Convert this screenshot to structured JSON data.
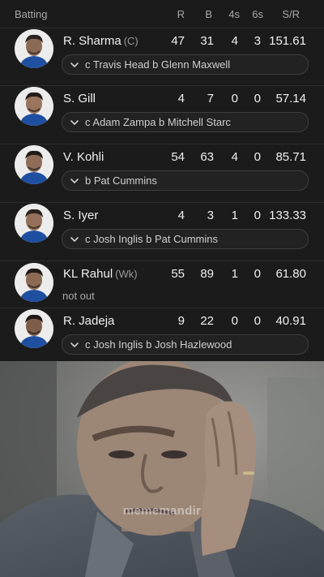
{
  "header": {
    "title": "Batting",
    "columns": [
      "R",
      "B",
      "4s",
      "6s",
      "S/R"
    ]
  },
  "batters": [
    {
      "name": "R. Sharma",
      "role": "(C)",
      "r": "47",
      "b": "31",
      "fours": "4",
      "sixes": "3",
      "sr": "151.61",
      "dismissal": "c Travis Head b Glenn Maxwell",
      "avatar_icon": "player-avatar-icon"
    },
    {
      "name": "S. Gill",
      "role": "",
      "r": "4",
      "b": "7",
      "fours": "0",
      "sixes": "0",
      "sr": "57.14",
      "dismissal": "c Adam Zampa b Mitchell Starc",
      "avatar_icon": "player-avatar-icon"
    },
    {
      "name": "V. Kohli",
      "role": "",
      "r": "54",
      "b": "63",
      "fours": "4",
      "sixes": "0",
      "sr": "85.71",
      "dismissal": "b Pat Cummins",
      "avatar_icon": "player-avatar-icon"
    },
    {
      "name": "S. Iyer",
      "role": "",
      "r": "4",
      "b": "3",
      "fours": "1",
      "sixes": "0",
      "sr": "133.33",
      "dismissal": "c Josh Inglis b Pat Cummins",
      "avatar_icon": "player-avatar-icon"
    },
    {
      "name": "KL Rahul",
      "role": "(Wk)",
      "r": "55",
      "b": "89",
      "fours": "1",
      "sixes": "0",
      "sr": "61.80",
      "status": "not out",
      "avatar_icon": "player-avatar-icon"
    },
    {
      "name": "R. Jadeja",
      "role": "",
      "r": "9",
      "b": "22",
      "fours": "0",
      "sixes": "0",
      "sr": "40.91",
      "dismissal": "c Josh Inglis b Josh Hazlewood",
      "avatar_icon": "player-avatar-icon"
    }
  ],
  "meme": {
    "watermark": "mememandir",
    "subject": "man-rubbing-forehead-photo"
  },
  "colors": {
    "background": "#1b1b1b",
    "text": "#f0f0f0",
    "muted": "#a8a8a8",
    "border": "#3e3e3e"
  }
}
